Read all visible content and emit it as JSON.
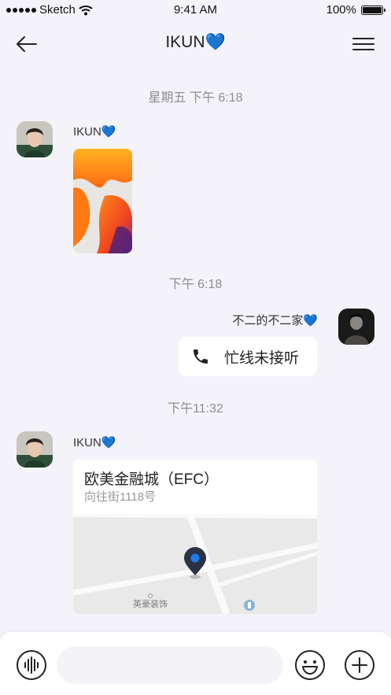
{
  "status_bar": {
    "carrier": "Sketch",
    "time": "9:41 AM",
    "battery": "100%"
  },
  "nav": {
    "title": "IKUN💙",
    "back_icon": "arrow-left-icon",
    "menu_icon": "hamburger-menu-icon"
  },
  "messages": [
    {
      "type": "time",
      "text": "星期五 下午 6:18"
    },
    {
      "type": "image",
      "sender": "IKUN💙",
      "side": "left"
    },
    {
      "type": "time",
      "text": "下午 6:18"
    },
    {
      "type": "call",
      "sender": "不二的不二家💙",
      "side": "right",
      "text": "忙线未接听",
      "icon": "phone-icon"
    },
    {
      "type": "time",
      "text": "下午11:32"
    },
    {
      "type": "location",
      "sender": "IKUN💙",
      "side": "left",
      "name": "欧美金融城（EFC）",
      "address": "向往街1118号",
      "map_poi": "英豪装饰",
      "pin_icon": "location-pin-icon"
    }
  ],
  "input_bar": {
    "voice_icon": "voice-wave-icon",
    "placeholder": "",
    "emoji_icon": "smiley-icon",
    "plus_icon": "plus-circle-icon"
  },
  "colors": {
    "background": "#f4f3f9",
    "bubble": "#ffffff",
    "time_text": "#8e8e93",
    "pin": "#2b3245",
    "pin_dot": "#1e7cf0"
  }
}
